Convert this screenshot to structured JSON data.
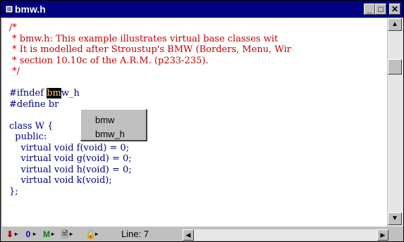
{
  "window": {
    "title": "bmw.h"
  },
  "title_buttons": {
    "minimize": "_",
    "maximize": "□",
    "close": "✕"
  },
  "code_lines": [
    {
      "parts": [
        {
          "text": "/*",
          "kind": "comment"
        }
      ]
    },
    {
      "parts": [
        {
          "text": " * bmw.h: This example illustrates virtual base classes wit",
          "kind": "comment"
        }
      ]
    },
    {
      "parts": [
        {
          "text": " * It is modelled after Stroustup's BMW (Borders, Menu, Wir",
          "kind": "comment"
        }
      ]
    },
    {
      "parts": [
        {
          "text": " * section 10.10c of the A.R.M. (p233-235).",
          "kind": "comment"
        }
      ]
    },
    {
      "parts": [
        {
          "text": " */",
          "kind": "comment"
        }
      ]
    },
    {
      "parts": [
        {
          "text": "",
          "kind": "normal"
        }
      ]
    },
    {
      "parts": [
        {
          "text": "#ifndef ",
          "kind": "normal"
        },
        {
          "text": "bm",
          "kind": "highlight"
        },
        {
          "text": "w_h",
          "kind": "normal"
        }
      ]
    },
    {
      "parts": [
        {
          "text": "#define br",
          "kind": "normal"
        }
      ]
    },
    {
      "parts": [
        {
          "text": "",
          "kind": "normal"
        }
      ]
    },
    {
      "parts": [
        {
          "text": "class W {",
          "kind": "normal"
        }
      ]
    },
    {
      "parts": [
        {
          "text": "  public:",
          "kind": "normal"
        }
      ]
    },
    {
      "parts": [
        {
          "text": "    virtual void f(void) = 0;",
          "kind": "normal"
        }
      ]
    },
    {
      "parts": [
        {
          "text": "    virtual void g(void) = 0;",
          "kind": "normal"
        }
      ]
    },
    {
      "parts": [
        {
          "text": "    virtual void h(void) = 0;",
          "kind": "normal"
        }
      ]
    },
    {
      "parts": [
        {
          "text": "    virtual void k(void);",
          "kind": "normal"
        }
      ]
    },
    {
      "parts": [
        {
          "text": "};",
          "kind": "normal"
        }
      ]
    }
  ],
  "completion_popup": {
    "items": [
      "bmw",
      "bmw_h"
    ]
  },
  "statusbar": {
    "icons": [
      "bookmark-icon",
      "zero-icon",
      "m-icon",
      "document-icon",
      "lock-icon"
    ],
    "icon_glyphs": [
      "⬇",
      "0",
      "M",
      "🗎",
      "🔓"
    ],
    "line_label": "Line: 7"
  },
  "colors": {
    "comment": "#c00000",
    "code": "#000080",
    "titlebar": "#000080"
  }
}
